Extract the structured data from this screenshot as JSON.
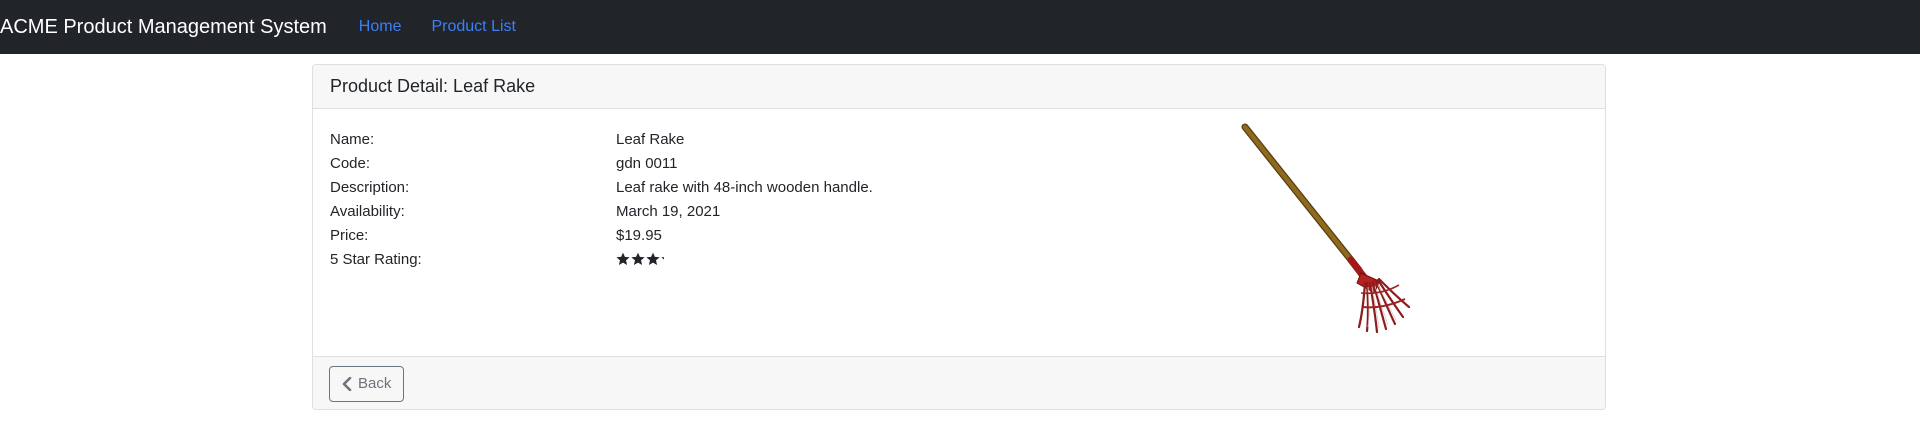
{
  "navbar": {
    "brand": "ACME Product Management System",
    "links": [
      {
        "label": "Home"
      },
      {
        "label": "Product List"
      }
    ],
    "link_color": "#3d7ff5",
    "background": "#212529"
  },
  "card": {
    "header_title": "Product Detail: Leaf Rake",
    "fields": [
      {
        "label": "Name:",
        "value": "Leaf Rake"
      },
      {
        "label": "Code:",
        "value": "gdn 0011"
      },
      {
        "label": "Description:",
        "value": "Leaf rake with 48-inch wooden handle."
      },
      {
        "label": "Availability:",
        "value": "March 19, 2021"
      },
      {
        "label": "Price:",
        "value": "$19.95"
      },
      {
        "label": "5 Star Rating:"
      }
    ],
    "rating": 3.2,
    "rating_max": 5,
    "image_icon": "leaf-rake-image"
  },
  "footer": {
    "back_label": "Back",
    "back_icon": "chevron-left-icon"
  }
}
